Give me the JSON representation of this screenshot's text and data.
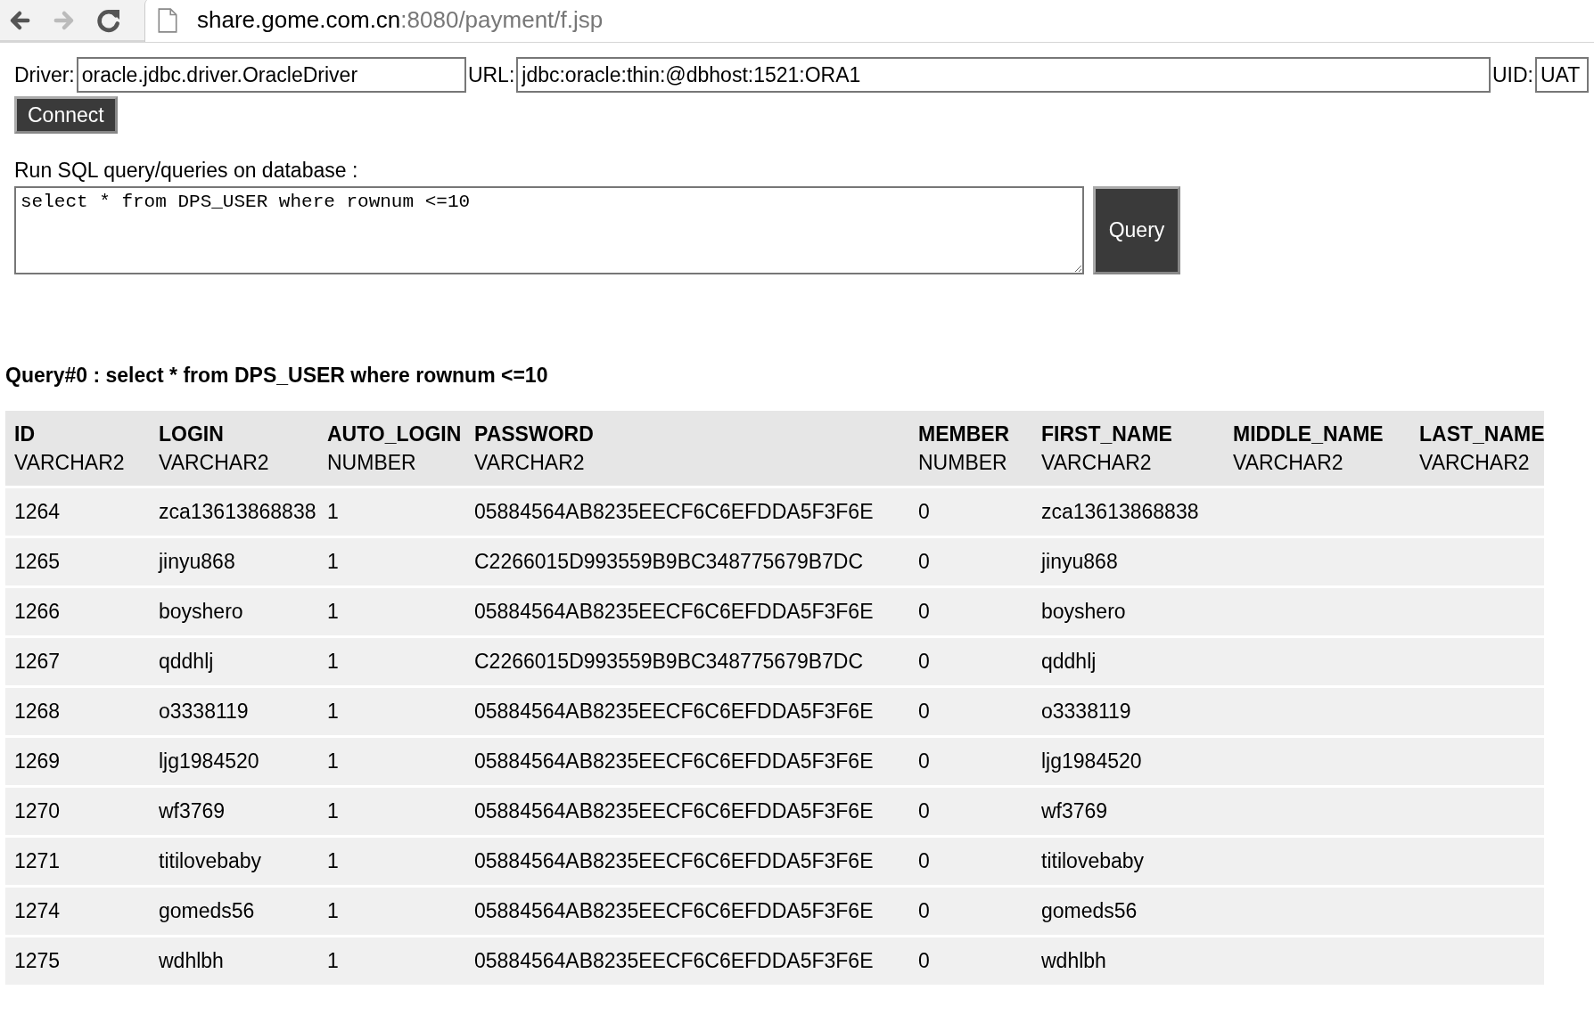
{
  "browser": {
    "nav_buttons": [
      {
        "kind": "back",
        "disabled": false
      },
      {
        "kind": "forward",
        "disabled": true
      },
      {
        "kind": "reload",
        "disabled": false
      }
    ],
    "url_host": "share.gome.com.cn",
    "url_rest": ":8080/payment/f.jsp"
  },
  "connection": {
    "fields": [
      {
        "label": "Driver:",
        "value": "oracle.jdbc.driver.OracleDriver",
        "kind": "driver"
      },
      {
        "label": "URL:",
        "value": "jdbc:oracle:thin:@dbhost:1521:ORA1",
        "kind": "url"
      },
      {
        "label": "UID:",
        "value": "UAT",
        "kind": "uid"
      }
    ],
    "button": "Connect"
  },
  "sql": {
    "label": "Run SQL query/queries on database :",
    "value": "select * from DPS_USER where rownum <=10",
    "button": "Query"
  },
  "result": {
    "title": "Query#0 : select * from DPS_USER where rownum <=10",
    "columns": [
      {
        "name": "ID",
        "type": "VARCHAR2"
      },
      {
        "name": "LOGIN",
        "type": "VARCHAR2"
      },
      {
        "name": "AUTO_LOGIN",
        "type": "NUMBER"
      },
      {
        "name": "PASSWORD",
        "type": "VARCHAR2"
      },
      {
        "name": "MEMBER",
        "type": "NUMBER"
      },
      {
        "name": "FIRST_NAME",
        "type": "VARCHAR2"
      },
      {
        "name": "MIDDLE_NAME",
        "type": "VARCHAR2"
      },
      {
        "name": "LAST_NAME",
        "type": "VARCHAR2"
      }
    ],
    "rows": [
      [
        "1264",
        "zca13613868838",
        "1",
        "05884564AB8235EECF6C6EFDDA5F3F6E",
        "0",
        "zca13613868838"
      ],
      [
        "1265",
        "jinyu868",
        "1",
        "C2266015D993559B9BC348775679B7DC",
        "0",
        "jinyu868"
      ],
      [
        "1266",
        "boyshero",
        "1",
        "05884564AB8235EECF6C6EFDDA5F3F6E",
        "0",
        "boyshero"
      ],
      [
        "1267",
        "qddhlj",
        "1",
        "C2266015D993559B9BC348775679B7DC",
        "0",
        "qddhlj"
      ],
      [
        "1268",
        "o3338119",
        "1",
        "05884564AB8235EECF6C6EFDDA5F3F6E",
        "0",
        "o3338119"
      ],
      [
        "1269",
        "ljg1984520",
        "1",
        "05884564AB8235EECF6C6EFDDA5F3F6E",
        "0",
        "ljg1984520"
      ],
      [
        "1270",
        "wf3769",
        "1",
        "05884564AB8235EECF6C6EFDDA5F3F6E",
        "0",
        "wf3769"
      ],
      [
        "1271",
        "titilovebaby",
        "1",
        "05884564AB8235EECF6C6EFDDA5F3F6E",
        "0",
        "titilovebaby"
      ],
      [
        "1274",
        "gomeds56",
        "1",
        "05884564AB8235EECF6C6EFDDA5F3F6E",
        "0",
        "gomeds56"
      ],
      [
        "1275",
        "wdhlbh",
        "1",
        "05884564AB8235EECF6C6EFDDA5F3F6E",
        "0",
        "wdhlbh"
      ]
    ]
  }
}
